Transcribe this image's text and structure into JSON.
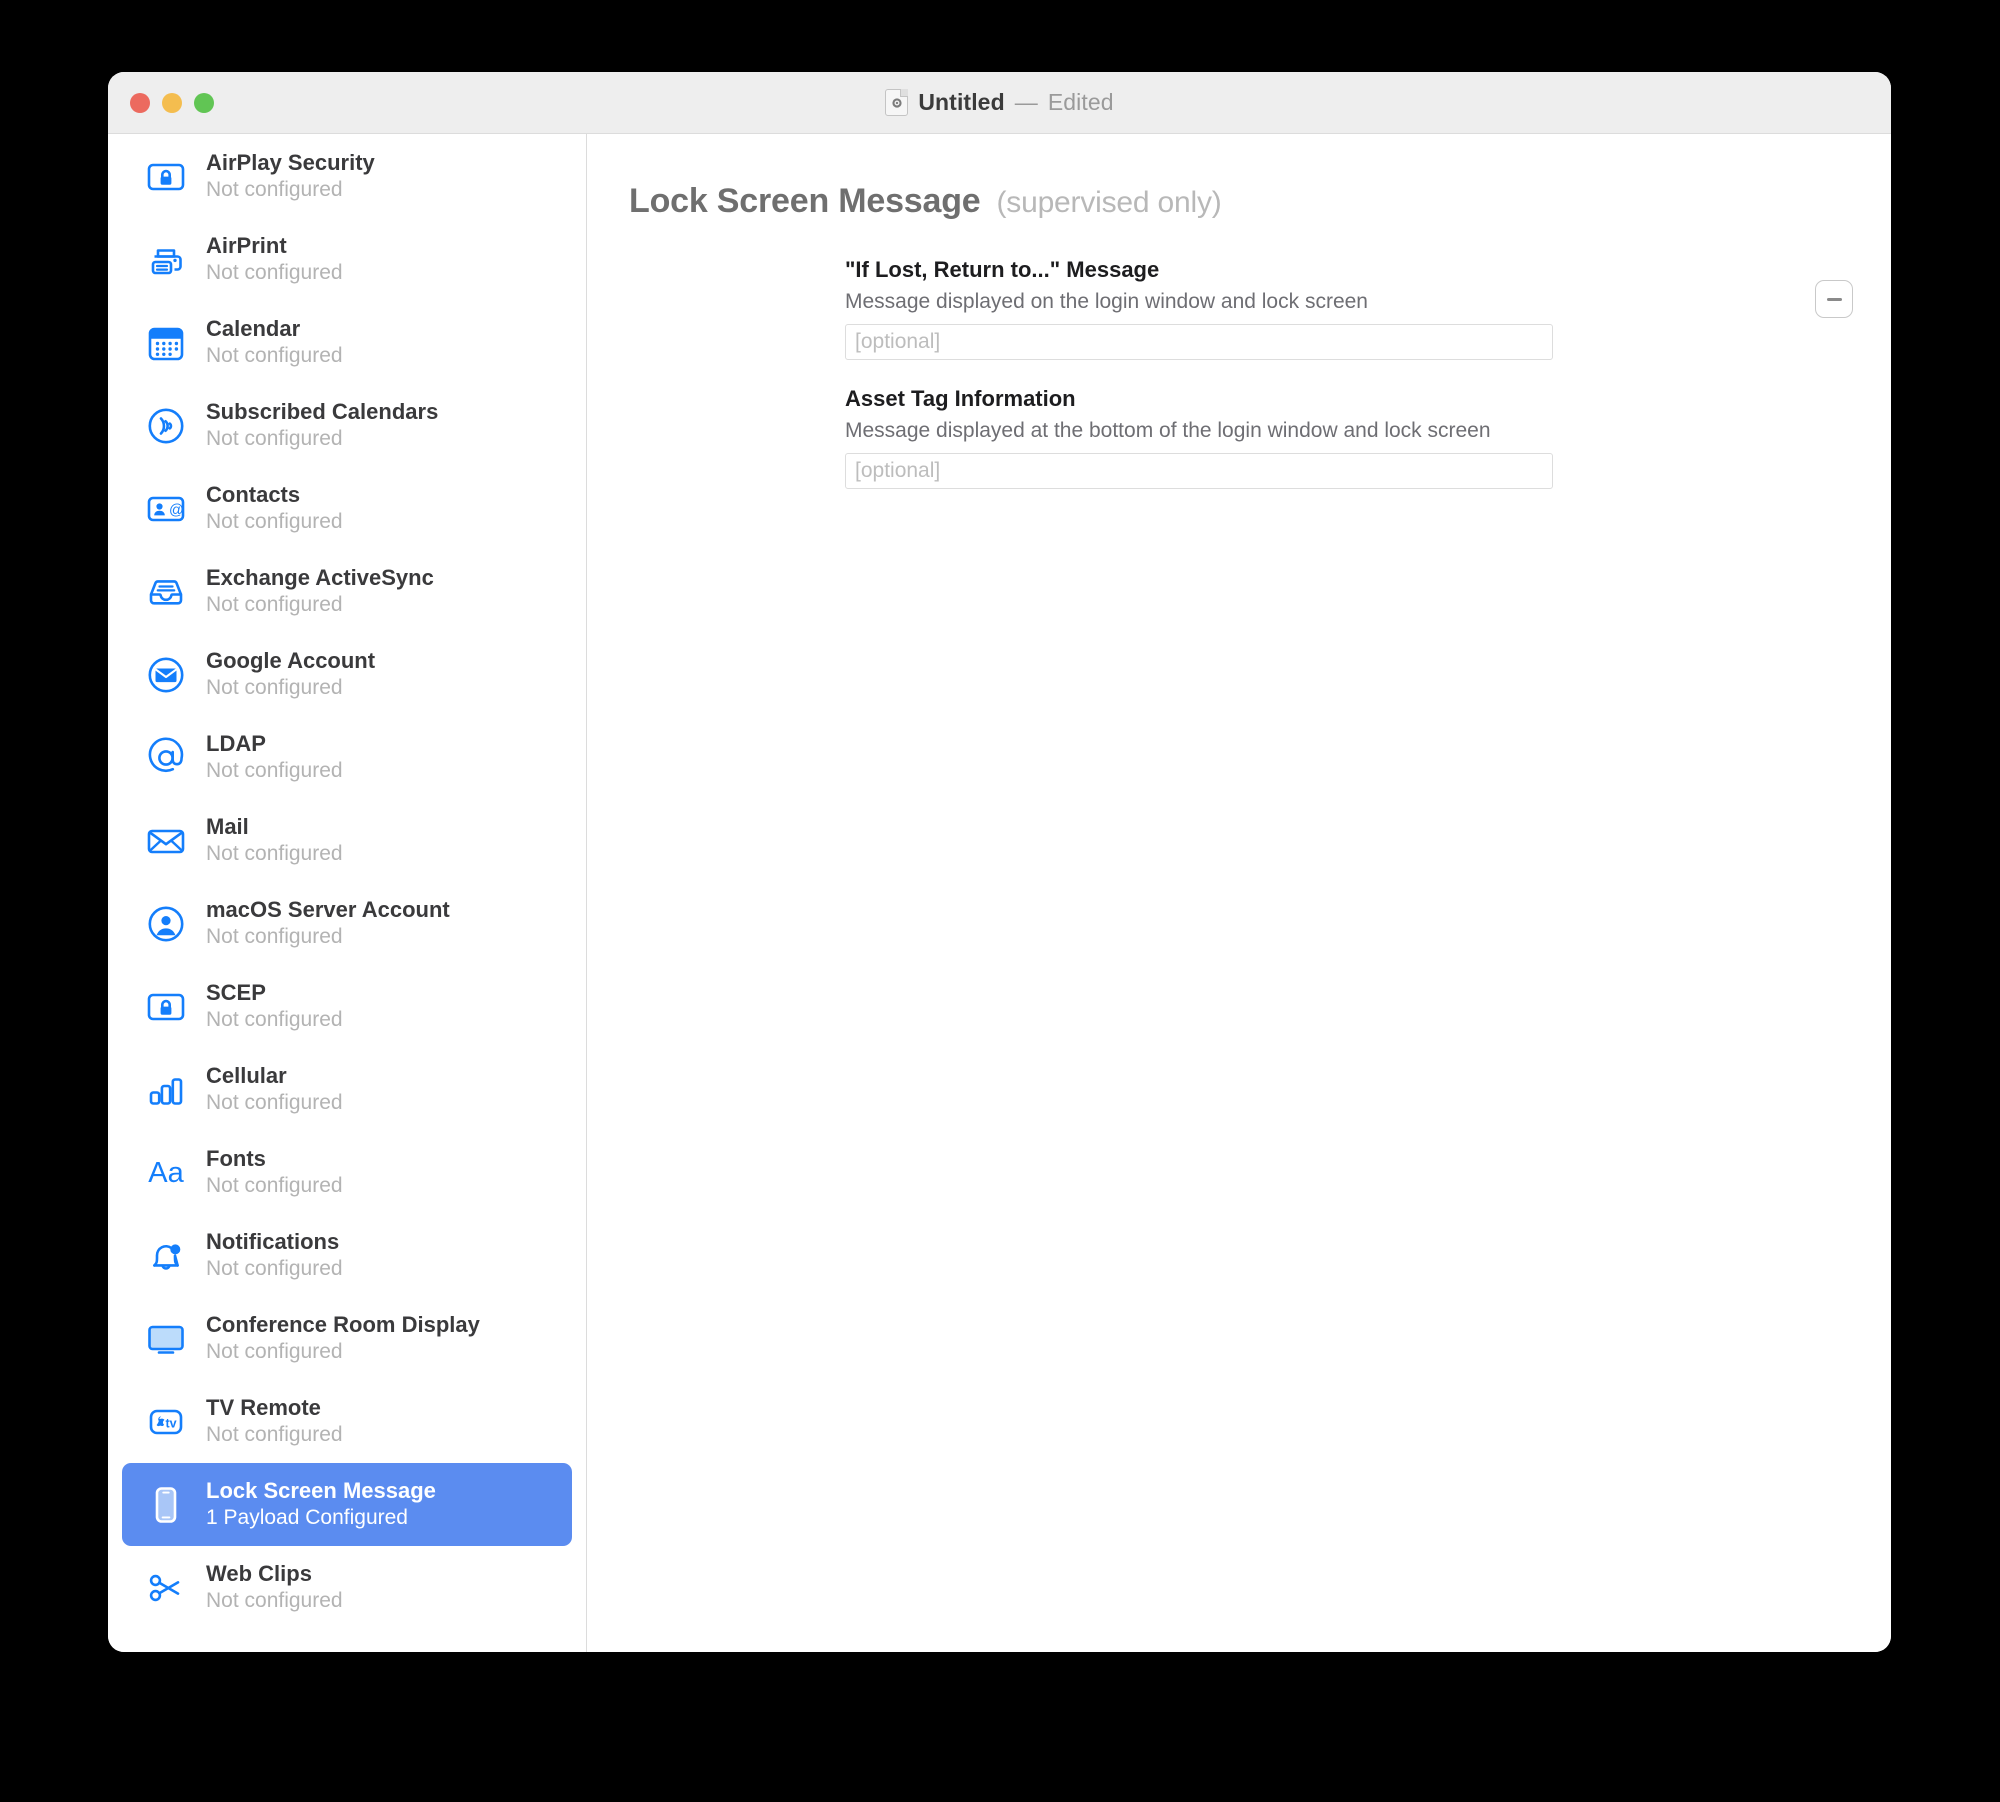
{
  "window": {
    "title_name": "Untitled",
    "title_dash": "—",
    "title_state": "Edited",
    "doc_icon": "profile-document-icon",
    "traffic_lights": {
      "close": "close-window-button",
      "minimize": "minimize-window-button",
      "zoom": "zoom-window-button"
    },
    "accent_color": "#5b8cf0",
    "icon_color": "#147efb"
  },
  "sidebar": {
    "items": [
      {
        "label": "AirPlay Security",
        "status": "Not configured",
        "icon": "airplay-security-icon",
        "selected": false
      },
      {
        "label": "AirPrint",
        "status": "Not configured",
        "icon": "airprint-icon",
        "selected": false
      },
      {
        "label": "Calendar",
        "status": "Not configured",
        "icon": "calendar-icon",
        "selected": false
      },
      {
        "label": "Subscribed Calendars",
        "status": "Not configured",
        "icon": "subscribed-calendars-icon",
        "selected": false
      },
      {
        "label": "Contacts",
        "status": "Not configured",
        "icon": "contacts-icon",
        "selected": false
      },
      {
        "label": "Exchange ActiveSync",
        "status": "Not configured",
        "icon": "exchange-activesync-icon",
        "selected": false
      },
      {
        "label": "Google Account",
        "status": "Not configured",
        "icon": "google-account-icon",
        "selected": false
      },
      {
        "label": "LDAP",
        "status": "Not configured",
        "icon": "ldap-at-icon",
        "selected": false
      },
      {
        "label": "Mail",
        "status": "Not configured",
        "icon": "mail-envelope-icon",
        "selected": false
      },
      {
        "label": "macOS Server Account",
        "status": "Not configured",
        "icon": "macos-server-account-icon",
        "selected": false
      },
      {
        "label": "SCEP",
        "status": "Not configured",
        "icon": "scep-lock-icon",
        "selected": false
      },
      {
        "label": "Cellular",
        "status": "Not configured",
        "icon": "cellular-bars-icon",
        "selected": false
      },
      {
        "label": "Fonts",
        "status": "Not configured",
        "icon": "fonts-aa-icon",
        "selected": false
      },
      {
        "label": "Notifications",
        "status": "Not configured",
        "icon": "notifications-bell-icon",
        "selected": false
      },
      {
        "label": "Conference Room Display",
        "status": "Not configured",
        "icon": "conference-room-display-icon",
        "selected": false
      },
      {
        "label": "TV Remote",
        "status": "Not configured",
        "icon": "tv-remote-icon",
        "selected": false
      },
      {
        "label": "Lock Screen Message",
        "status": "1 Payload Configured",
        "icon": "lock-screen-message-icon",
        "selected": true
      },
      {
        "label": "Web Clips",
        "status": "Not configured",
        "icon": "web-clips-scissors-icon",
        "selected": false
      }
    ]
  },
  "content": {
    "payload_title": "Lock Screen Message",
    "payload_subtitle": "(supervised only)",
    "remove_button": "−",
    "fields": [
      {
        "label": "\"If Lost, Return to...\" Message",
        "help": "Message displayed on the login window and lock screen",
        "value": "",
        "placeholder": "[optional]"
      },
      {
        "label": "Asset Tag Information",
        "help": "Message displayed at the bottom of the login window and lock screen",
        "value": "",
        "placeholder": "[optional]"
      }
    ]
  }
}
